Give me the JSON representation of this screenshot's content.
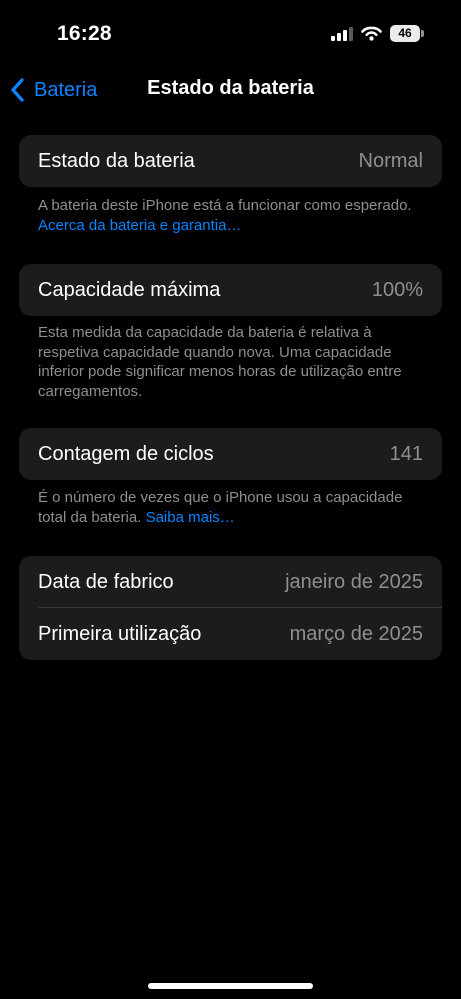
{
  "status_bar": {
    "time": "16:28",
    "battery_percent": "46",
    "signal_bars_active": 3,
    "signal_bars_total": 4
  },
  "nav": {
    "back_label": "Bateria",
    "title": "Estado da bateria"
  },
  "health": {
    "label": "Estado da bateria",
    "value": "Normal",
    "footnote_text": "A bateria deste iPhone está a funcionar como esperado.",
    "footnote_link": "Acerca da bateria e garantia…"
  },
  "capacity": {
    "label": "Capacidade máxima",
    "value": "100%",
    "footnote_text": "Esta medida da capacidade da bateria é relativa à respetiva capacidade quando nova. Uma capacidade inferior pode significar menos horas de utilização entre carregamentos."
  },
  "cycles": {
    "label": "Contagem de ciclos",
    "value": "141",
    "footnote_text": "É o número de vezes que o iPhone usou a capacidade total da bateria.",
    "footnote_link": "Saiba mais…"
  },
  "dates": {
    "manufacture_label": "Data de fabrico",
    "manufacture_value": "janeiro de 2025",
    "first_use_label": "Primeira utilização",
    "first_use_value": "março de 2025"
  },
  "colors": {
    "accent": "#0a84ff",
    "background": "#000000",
    "card": "#1c1c1e",
    "secondary_text": "#8e8e93"
  },
  "icons": {
    "back": "chevron-left-icon",
    "signal": "cellular-signal-icon",
    "wifi": "wifi-icon",
    "battery": "battery-icon"
  }
}
